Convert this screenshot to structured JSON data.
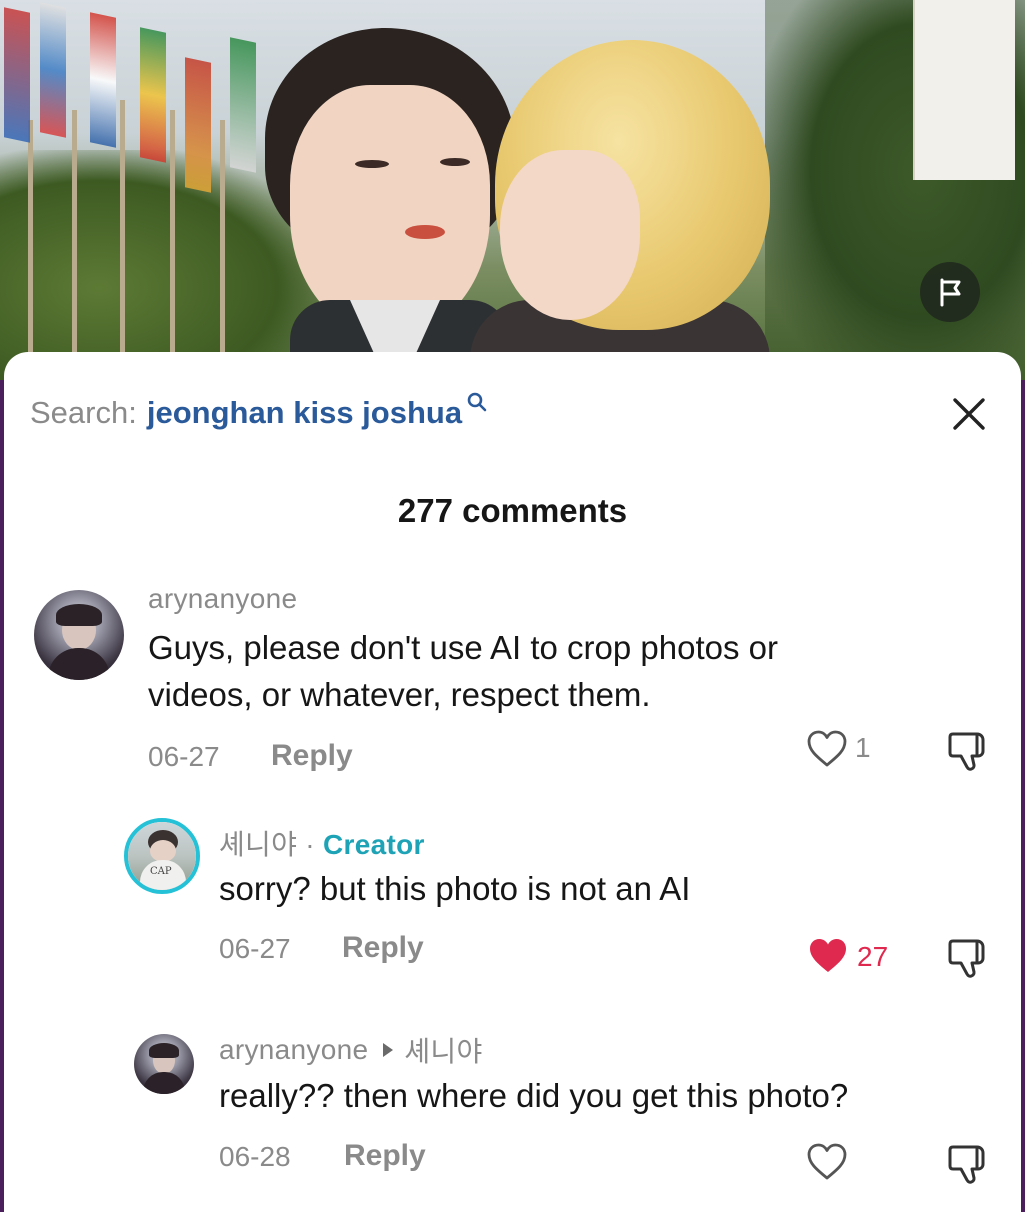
{
  "header": {
    "search_label": "Search:",
    "search_query": "jeonghan kiss joshua",
    "comment_count_text": "277 comments"
  },
  "icons": {
    "report": "flag-icon",
    "search": "search-icon",
    "close": "close-icon",
    "like": "heart-icon",
    "dislike": "thumbs-down-icon",
    "reply_arrow": "triangle-right-icon"
  },
  "colors": {
    "accent_creator": "#1ea3b6",
    "liked": "#e0294e",
    "search_link": "#2a5a9a",
    "muted": "#8a8a8a"
  },
  "comments": [
    {
      "username": "arynanyone",
      "text_line1": "Guys, please don't use AI to crop photos or",
      "text_line2": "videos, or whatever, respect them.",
      "date": "06-27",
      "reply_label": "Reply",
      "likes": "1",
      "liked": false
    },
    {
      "username": "셰니야",
      "separator": "·",
      "badge": "Creator",
      "text": "sorry? but this photo is not an AI",
      "date": "06-27",
      "reply_label": "Reply",
      "likes": "27",
      "liked": true
    },
    {
      "username": "arynanyone",
      "reply_to": "셰니야",
      "text": "really?? then where did you get this photo?",
      "date": "06-28",
      "reply_label": "Reply",
      "likes": "",
      "liked": false
    }
  ]
}
